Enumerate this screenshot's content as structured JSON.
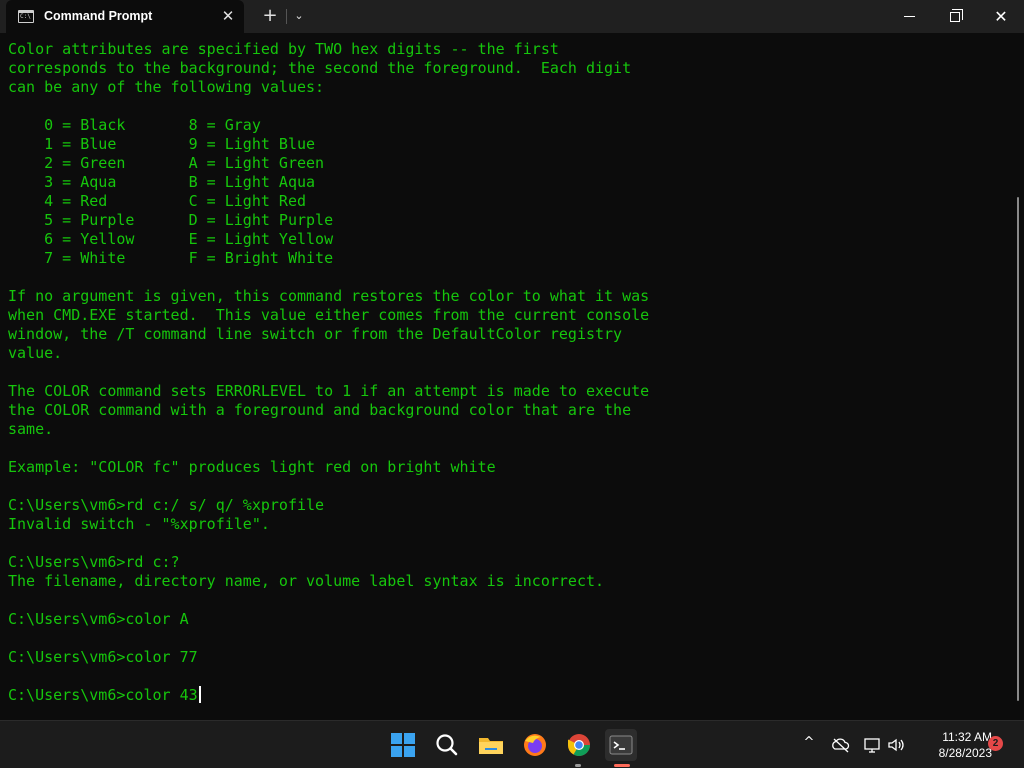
{
  "window": {
    "tab_title": "Command Prompt",
    "tab_icon_text": "C:\\",
    "new_tab_symbol": "+",
    "dropdown_symbol": "⌄",
    "close_tab_symbol": "✕",
    "close_symbol": "✕"
  },
  "terminal": {
    "text_color": "#16c60c",
    "background": "#0c0c0c",
    "lines": [
      "Color attributes are specified by TWO hex digits -- the first",
      "corresponds to the background; the second the foreground.  Each digit",
      "can be any of the following values:",
      "",
      "    0 = Black       8 = Gray",
      "    1 = Blue        9 = Light Blue",
      "    2 = Green       A = Light Green",
      "    3 = Aqua        B = Light Aqua",
      "    4 = Red         C = Light Red",
      "    5 = Purple      D = Light Purple",
      "    6 = Yellow      E = Light Yellow",
      "    7 = White       F = Bright White",
      "",
      "If no argument is given, this command restores the color to what it was",
      "when CMD.EXE started.  This value either comes from the current console",
      "window, the /T command line switch or from the DefaultColor registry",
      "value.",
      "",
      "The COLOR command sets ERRORLEVEL to 1 if an attempt is made to execute",
      "the COLOR command with a foreground and background color that are the",
      "same.",
      "",
      "Example: \"COLOR fc\" produces light red on bright white",
      "",
      "C:\\Users\\vm6>rd c:/ s/ q/ %xprofile",
      "Invalid switch - \"%xprofile\".",
      "",
      "C:\\Users\\vm6>rd c:?",
      "The filename, directory name, or volume label syntax is incorrect.",
      "",
      "C:\\Users\\vm6>color A",
      "",
      "C:\\Users\\vm6>color 77",
      ""
    ],
    "current_prompt": "C:\\Users\\vm6>color 43"
  },
  "taskbar": {
    "apps": [
      {
        "name": "start-button-icon"
      },
      {
        "name": "search-icon"
      },
      {
        "name": "file-explorer-icon"
      },
      {
        "name": "firefox-icon"
      },
      {
        "name": "chrome-icon"
      },
      {
        "name": "terminal-icon"
      }
    ],
    "tray_chevron": "^",
    "time": "11:32 AM",
    "date": "8/28/2023",
    "notification_count": "2"
  }
}
